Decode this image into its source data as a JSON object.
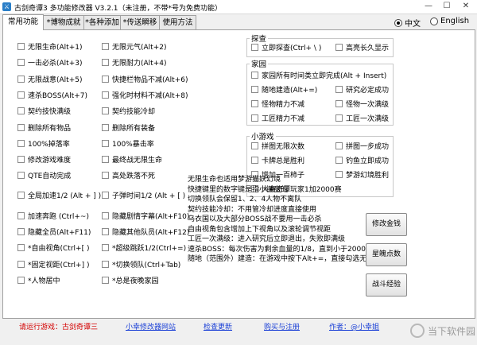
{
  "window": {
    "title": "古剑奇谭3 多功能修改器  V3.2.1（未注册，不带*号为免费功能）",
    "min": "—",
    "max": "☐",
    "close": "✕"
  },
  "tabs": [
    "常用功能",
    "*博物成就",
    "*各种添加",
    "*传送瞬移",
    "使用方法"
  ],
  "language": {
    "zh": "中文",
    "en": "English",
    "selected": "zh"
  },
  "col1": [
    "无限生命(Alt+1)",
    "一击必杀(Alt+3)",
    "无限战意(Alt+5)",
    "速杀BOSS(Alt+7)",
    "契约技快满级",
    "删除所有物品",
    "100%掉落率",
    "修改游戏难度",
    "QTE自动完成",
    "全局加速1/2 (Alt + ] )",
    "加速奔跑 (Ctrl+~)",
    "隐藏全员(Alt+F11)",
    "*自由视角(Ctrl+[ )",
    "*固定视距(Ctrl+] )",
    "*人物居中"
  ],
  "col2": [
    "无限元气(Alt+2)",
    "无限耐力(Alt+4)",
    "快捷栏物品不减(Alt+6)",
    "强化时材料不减(Alt+8)",
    "契约技能冷却",
    "删除所有装备",
    "100%暴击率",
    "最终战无限生命",
    "高处跌落不死",
    "子弹时间1/2 (Alt + [ )",
    "隐藏剧情字幕(Alt+F10)",
    "隐藏其他队员(Alt+F12)",
    "*超级跳跃1/2(Ctrl+=)",
    "*切换领队(Ctrl+Tab)",
    "*总是夜晚家园"
  ],
  "explore": {
    "title": "探查",
    "items": [
      "立即探查(Ctrl+ \\ )",
      "高亮长久显示"
    ]
  },
  "home": {
    "title": "家园",
    "items": [
      "家园所有时间类立即完成(Alt + Insert)",
      "随地建造(Alt+=)",
      "研究必定成功",
      "怪物精力不减",
      "怪物一次满级",
      "工匠精力不减",
      "工匠一次满级"
    ]
  },
  "minigame": {
    "title": "小游戏",
    "items": [
      "拼图无限次数",
      "拼图一步成功",
      "卡牌总是胜利",
      "钓鱼立即成功",
      "增加一百柿子",
      "梦游幻境胜利",
      "大赛奇谭玩家1加2000赛"
    ]
  },
  "info": [
    "无限生命也适用梦游猫妖幻境",
    "快捷键里的数字键是指小键盘的",
    "切换领队会保留1、2、4人物不离队",
    "契约技能冷却：不用管冷却进度直接使用",
    "乌衣国以及大部分BOSS战不要用一击必杀",
    "自由视角包含增加上下视角以及滚轮调节视距",
    "工匠一次满级：进入研究后立即退出，失败即满级",
    "速杀BOSS：每次伤害为剩余血量的1/8，直到小于2000",
    "随地（范围外）建造：在游戏中按下Alt+=，直接勾选无效"
  ],
  "buttons": [
    "修改金钱",
    "星魄点数",
    "战斗经验"
  ],
  "footer": {
    "status": "请运行游戏：古剑奇谭三",
    "site": "小幸修改器网站",
    "update": "检查更新",
    "register": "购买与注册",
    "author": "作者：@小幸姐"
  },
  "watermark": "当下软件园"
}
